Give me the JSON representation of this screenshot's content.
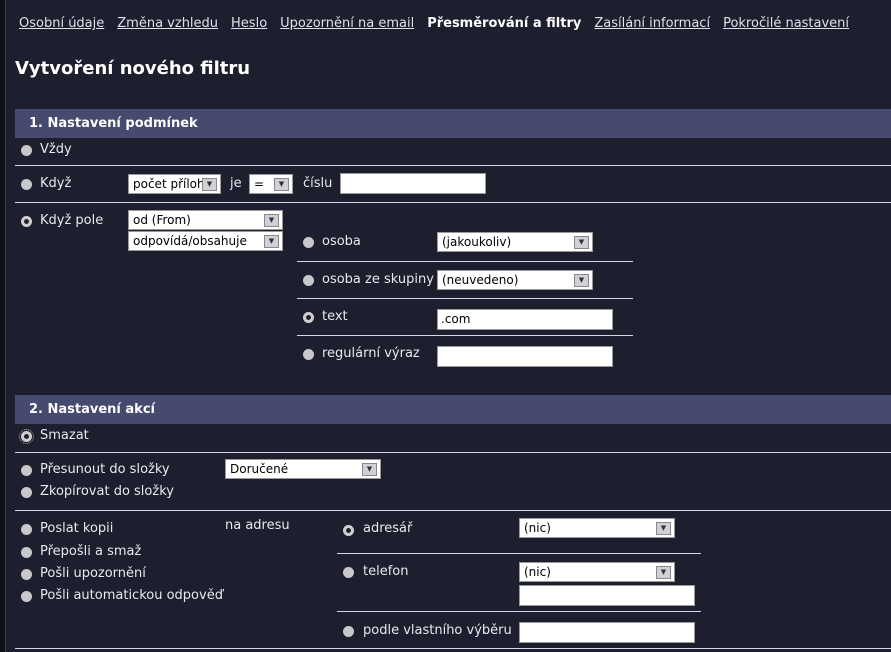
{
  "nav": {
    "items": [
      "Osobní údaje",
      "Změna vzhledu",
      "Heslo",
      "Upozornění na email"
    ],
    "active": "Přesměrování a filtry",
    "items_after": [
      "Zasílání informací",
      "Pokročilé nastavení"
    ]
  },
  "title": "Vytvoření nového filtru",
  "section1": {
    "title": "1. Nastavení podmínek",
    "always": "Vždy",
    "when": {
      "label": "Když",
      "field": "počet příloh",
      "je": "je",
      "op": "=",
      "cislu": "číslu",
      "value": ""
    },
    "when_field": {
      "label": "Když pole",
      "field": "od (From)",
      "match": "odpovídá/obsahuje",
      "person": {
        "label": "osoba",
        "value": "(jakoukoliv)"
      },
      "group": {
        "label": "osoba ze skupiny",
        "value": "(neuvedeno)"
      },
      "text": {
        "label": "text",
        "value": ".com"
      },
      "regex": {
        "label": "regulární výraz",
        "value": ""
      }
    }
  },
  "section2": {
    "title": "2. Nastavení akcí",
    "delete": "Smazat",
    "move": "Přesunout do složky",
    "copy": "Zkopírovat do složky",
    "folder": "Doručené",
    "send_copy": "Poslat kopii",
    "forward_delete": "Přepošli a smaž",
    "notify": "Pošli upozornění",
    "autoreply": "Pošli automatickou odpověď",
    "to_address": "na adresu",
    "addressbook": {
      "label": "adresář",
      "value": "(nic)"
    },
    "phone": {
      "label": "telefon",
      "value": "(nic)",
      "input": ""
    },
    "custom": {
      "label": "podle vlastního výběru",
      "value": ""
    }
  }
}
